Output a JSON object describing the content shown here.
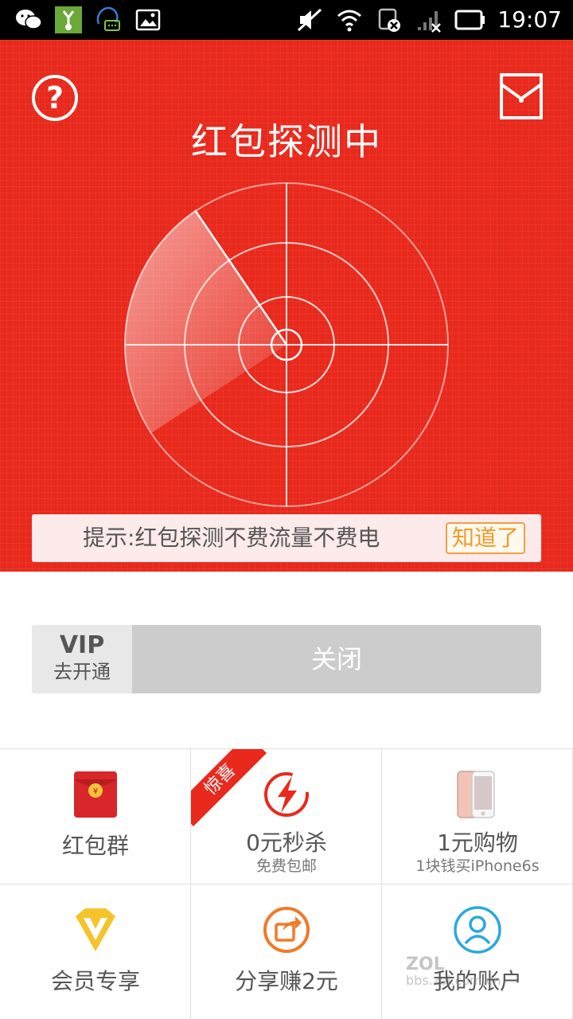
{
  "status_bar": {
    "time": "19:07",
    "left_icons": [
      "wechat-icon",
      "app-icon",
      "chat-icon",
      "image-icon"
    ],
    "right_icons": [
      "mute-icon",
      "wifi-icon",
      "sim-off-icon",
      "signal-icon",
      "battery-icon"
    ]
  },
  "header": {
    "title": "红包探测中",
    "background_color": "#e8291c",
    "tip_text": "提示:红包探测不费流量不费电",
    "tip_button": "知道了"
  },
  "controls": {
    "vip_title": "VIP",
    "vip_subtitle": "去开通",
    "close_label": "关闭"
  },
  "grid": {
    "items": [
      {
        "label": "红包群",
        "sub": "",
        "icon": "red-envelope-icon"
      },
      {
        "label": "0元秒杀",
        "sub": "免费包邮",
        "icon": "lightning-icon",
        "badge": "惊喜"
      },
      {
        "label": "1元购物",
        "sub": "1块钱买iPhone6s",
        "icon": "phone-icon"
      },
      {
        "label": "会员专享",
        "sub": "",
        "icon": "vip-diamond-icon"
      },
      {
        "label": "分享赚2元",
        "sub": "",
        "icon": "share-icon"
      },
      {
        "label": "我的账户",
        "sub": "",
        "icon": "user-icon"
      }
    ]
  },
  "watermark": {
    "line1": "ZOL",
    "line2": "bbs.zol.com.cn"
  }
}
